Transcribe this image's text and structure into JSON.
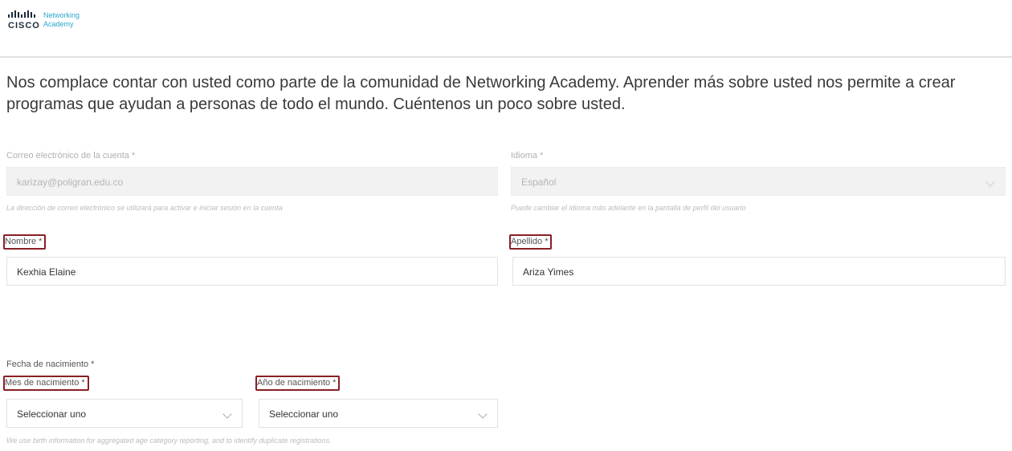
{
  "header": {
    "brand_word": "CISCO",
    "brand_line1": "Networking",
    "brand_line2": "Academy"
  },
  "intro": {
    "text": "Nos complace contar con usted como parte de la comunidad de Networking Academy. Aprender más sobre usted nos permite a crear programas que ayudan a personas de todo el mundo. Cuéntenos un poco sobre usted."
  },
  "form": {
    "email": {
      "label": "Correo electrónico de la cuenta *",
      "value": "karizay@poligran.edu.co",
      "help": "La dirección de correo electrónico se utilizará para activar e iniciar sesión en la cuenta"
    },
    "language": {
      "label": "Idioma *",
      "value": "Español",
      "help": "Puede cambiar el idioma más adelante en la pantalla de perfil del usuario"
    },
    "first_name": {
      "label": "Nombre *",
      "value": "Kexhia Elaine"
    },
    "last_name": {
      "label": "Apellido *",
      "value": "Ariza Yimes"
    },
    "birth": {
      "group_label": "Fecha de nacimiento *",
      "month_label": "Mes de nacimiento *",
      "month_value": "Seleccionar uno",
      "year_label": "Año de nacimiento *",
      "year_value": "Seleccionar uno",
      "help": "We use birth information for aggregated age category reporting, and to identify duplicate registrations."
    }
  },
  "colors": {
    "highlight_border": "#8a1f24",
    "brand_blue": "#2aa7c9",
    "text": "#3a3a3a"
  },
  "icons": [
    "cisco-logo",
    "chevron-down-icon"
  ]
}
